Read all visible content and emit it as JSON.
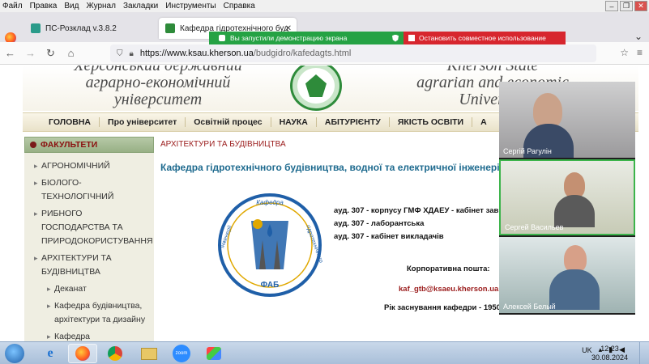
{
  "menu": [
    "Файл",
    "Правка",
    "Вид",
    "Журнал",
    "Закладки",
    "Инструменты",
    "Справка"
  ],
  "tabs": [
    {
      "label": "ПС-Розклад v.3.8.2",
      "favicon_color": "#2a9b8a"
    },
    {
      "label": "Кафедра гідротехнічного буд",
      "favicon_color": "#2e8b3a"
    }
  ],
  "share": {
    "notice": "Вы запустили демонстрацию экрана",
    "stop": "Остановить совместное использование"
  },
  "url": {
    "domain": "https://www.ksau.kherson.ua",
    "path": "/budgidro/kafedagts.html"
  },
  "site": {
    "name_ua": "Херсонський державний аграрно-економічний університет",
    "name_ua_lines": [
      "Херсонський державний",
      "аграрно-економічний",
      "університет"
    ],
    "name_en_lines": [
      "Kherson State",
      "agrarian and economic",
      "University"
    ]
  },
  "mainnav": [
    "ГОЛОВНА",
    "Про університет",
    "Освітній процес",
    "НАУКА",
    "АБІТУРІЄНТУ",
    "ЯКІСТЬ ОСВІТИ",
    "А"
  ],
  "sidebar": {
    "header": "ФАКУЛЬТЕТИ",
    "items": [
      {
        "label": "АГРОНОМІЧНИЙ",
        "sub": false
      },
      {
        "label": "БІОЛОГО-ТЕХНОЛОГІЧНИЙ",
        "sub": false
      },
      {
        "label": "РИБНОГО ГОСПОДАРСТВА ТА ПРИРОДОКОРИСТУВАННЯ",
        "sub": false
      },
      {
        "label": "АРХІТЕКТУРИ ТА БУДІВНИЦТВА",
        "sub": false
      },
      {
        "label": "Деканат",
        "sub": true
      },
      {
        "label": "Кафедра будівництва, архітектури та дизайну",
        "sub": true
      },
      {
        "label": "Кафедра гідротехнічного будівництва, водної та",
        "sub": true
      }
    ]
  },
  "content": {
    "crumb": "АРХІТЕКТУРИ ТА БУДІВНИЦТВА",
    "title": "Кафедра гідротехнічного будівництва, водної та електричної інженерії",
    "logo_top": "Кафедра",
    "logo_left": "інженерії",
    "logo_right": "гідротехнічного",
    "logo_bottom": "ФАБ",
    "rooms": [
      "ауд. 307 - корпусу ГМФ ХДАЕУ - кабінет зав",
      "ауд. 307 - лаборантська",
      "ауд. 307 - кабінет викладачів"
    ],
    "corp_label": "Корпоративна пошта:",
    "email": "kaf_gtb@ksaeu.kherson.ua",
    "founded": "Рік заснування кафедри - 1950"
  },
  "video": [
    {
      "name": "Сергій Рагулін"
    },
    {
      "name": "Сергей Васильев"
    },
    {
      "name": "Алексей Белый"
    }
  ],
  "taskbar": {
    "lang": "UK",
    "time": "12:23",
    "date": "30.08.2024",
    "apps": [
      "internet-explorer",
      "firefox",
      "chrome",
      "file-explorer",
      "zoom",
      "paint"
    ],
    "zoom_label": "zoom"
  }
}
